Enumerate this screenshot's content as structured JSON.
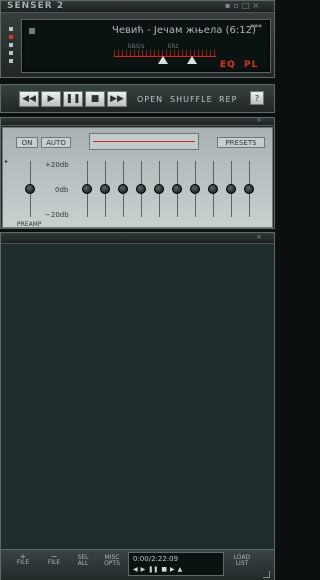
{
  "app": {
    "logo": "SENSER 2",
    "window_controls": [
      "▪",
      "▫",
      "□",
      "×"
    ],
    "more": "***"
  },
  "player": {
    "song": "Чевић - Јечам жњела (6:12)",
    "kbps_label": "kbit/s",
    "khz_label": "khz",
    "eq_toggle": "EQ",
    "pl_toggle": "PL"
  },
  "controls": {
    "prev": "◀◀",
    "play": "▶",
    "pause": "❚❚",
    "stop": "■",
    "next": "▶▶",
    "open": "OPEN",
    "shuffle": "SHUFFLE",
    "repeat": "REP",
    "menu": "?"
  },
  "eq": {
    "on": "ON",
    "auto": "AUTO",
    "presets": "PRESETS",
    "db_top": "+20db",
    "db_mid": "0db",
    "db_bottom": "−20db",
    "preamp": "PREAMP",
    "band_levels": [
      0,
      0,
      0,
      0,
      0,
      0,
      0,
      0,
      0,
      0
    ],
    "preamp_level": 0
  },
  "playlist": {
    "add_label": "+",
    "add_sub": "FILE",
    "remove_label": "−",
    "remove_sub": "FILE",
    "sel_label": "SEL",
    "sel_sub": "ALL",
    "misc_label": "MISC",
    "misc_sub": "OPTS",
    "time": "0:00/2:22:09",
    "load_label": "LOAD",
    "load_sub": "LIST",
    "mini_controls": [
      "◀",
      "▶",
      "❚❚",
      "■",
      "▶",
      "▲"
    ]
  }
}
